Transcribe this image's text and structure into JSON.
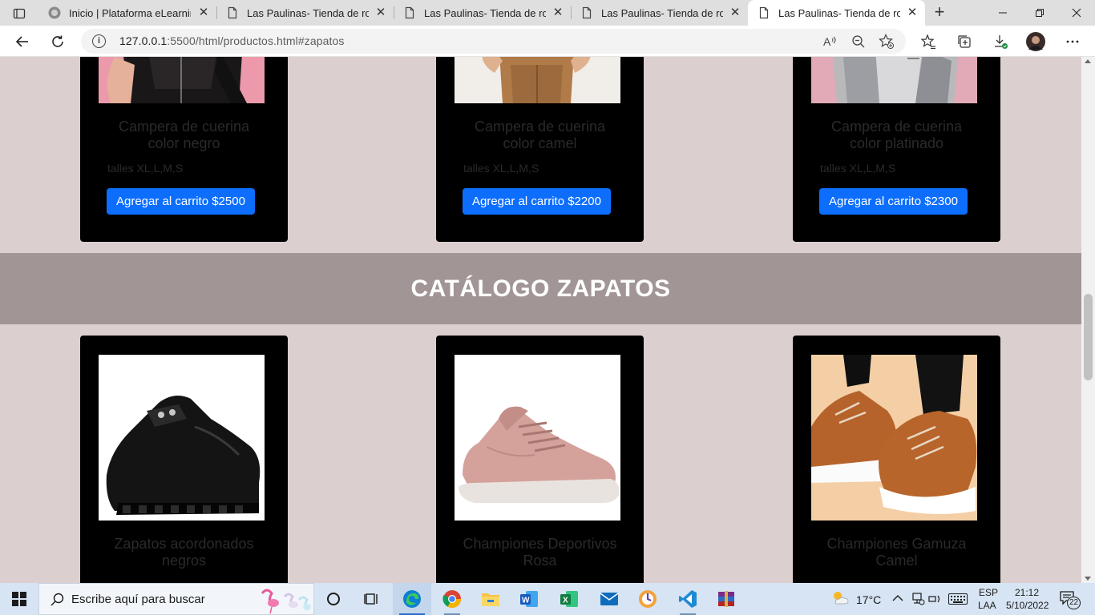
{
  "browser": {
    "tabs": [
      {
        "title": "Inicio | Plataforma eLearning",
        "active": false
      },
      {
        "title": "Las Paulinas- Tienda de ropa",
        "active": false
      },
      {
        "title": "Las Paulinas- Tienda de ropa",
        "active": false
      },
      {
        "title": "Las Paulinas- Tienda de ropa",
        "active": false
      },
      {
        "title": "Las Paulinas- Tienda de ropa",
        "active": true
      }
    ],
    "url_host": "127.0.0.1",
    "url_rest": ":5500/html/productos.html#zapatos"
  },
  "camperas": [
    {
      "title_line1": "Campera de cuerina",
      "title_line2": "color negro",
      "sizes": "talles XL,L,M,S",
      "button": "Agregar al carrito $2500"
    },
    {
      "title_line1": "Campera de cuerina",
      "title_line2": "color camel",
      "sizes": "talles XL,L,M,S",
      "button": "Agregar al carrito $2200"
    },
    {
      "title_line1": "Campera de cuerina",
      "title_line2": "color platinado",
      "sizes": "talles XL,L,M,S",
      "button": "Agregar al carrito $2300"
    }
  ],
  "section": {
    "title": "CATÁLOGO ZAPATOS"
  },
  "zapatos": [
    {
      "title_line1": "Zapatos acordonados",
      "title_line2": "negros"
    },
    {
      "title_line1": "Championes Deportivos",
      "title_line2": "Rosa"
    },
    {
      "title_line1": "Championes Gamuza",
      "title_line2": "Camel"
    }
  ],
  "taskbar": {
    "search_placeholder": "Escribe aquí para buscar",
    "weather": "17°C",
    "lang_line1": "ESP",
    "lang_line2": "LAA",
    "time": "21:12",
    "date": "5/10/2022",
    "notifications": "22"
  },
  "colors": {
    "page_bg": "#dccfd0",
    "band_bg": "#a29596",
    "card_bg": "#000000",
    "button_bg": "#0d6efd"
  }
}
